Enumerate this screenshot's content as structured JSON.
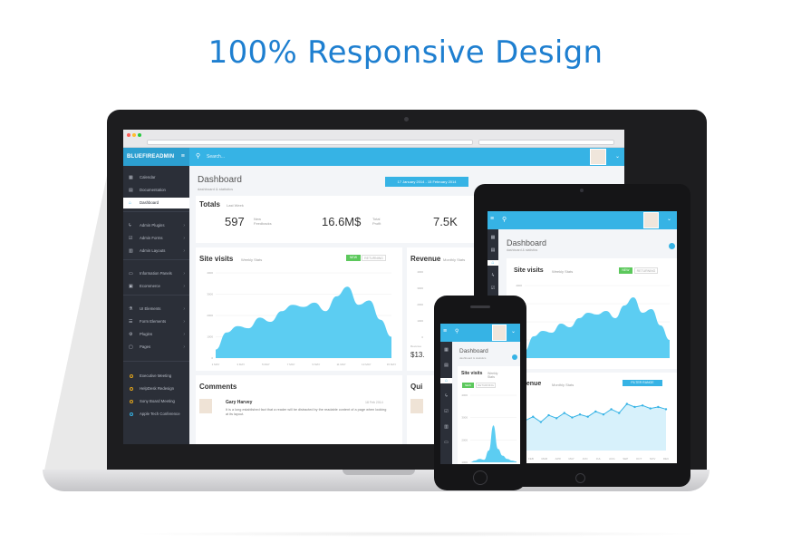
{
  "headline": "100% Responsive Design",
  "colors": {
    "accent": "#36b3e5",
    "headline": "#1e7fd0",
    "sidebar": "#2b2f38",
    "chart_fill": "#5ccdf2"
  },
  "laptop": {
    "brand": "BLUEFIREADMIN",
    "search_label": "Search...",
    "sidebar": {
      "items": [
        {
          "label": "Calendar",
          "icon": "calendar-icon",
          "arrow": false
        },
        {
          "label": "Documentation",
          "icon": "document-icon",
          "arrow": false
        },
        {
          "label": "Dashboard",
          "icon": "home-icon",
          "arrow": false,
          "active": true
        },
        {
          "label": "Admin Plugins",
          "icon": "plug-icon",
          "arrow": true
        },
        {
          "label": "Admin Forms",
          "icon": "check-icon",
          "arrow": true
        },
        {
          "label": "Admin Layouts",
          "icon": "layout-icon",
          "arrow": true
        },
        {
          "label": "Information Panels",
          "icon": "panel-icon",
          "arrow": true
        },
        {
          "label": "Ecommerce",
          "icon": "cart-icon",
          "arrow": true
        },
        {
          "label": "UI Elements",
          "icon": "flask-icon",
          "arrow": true
        },
        {
          "label": "Form Elements",
          "icon": "form-icon",
          "arrow": true
        },
        {
          "label": "Plugins",
          "icon": "gear-icon",
          "arrow": true
        },
        {
          "label": "Pages",
          "icon": "pages-icon",
          "arrow": true
        }
      ],
      "projects": [
        {
          "label": "Executive Meeting",
          "color": "#e3a51b"
        },
        {
          "label": "HelpDesk Redesign",
          "color": "#e3a51b"
        },
        {
          "label": "Sony Board Meeting",
          "color": "#e3a51b"
        },
        {
          "label": "Apple Tech Conference",
          "color": "#36b3e5"
        }
      ]
    },
    "page_title": "Dashboard",
    "page_subtitle": "dashboard & statistics",
    "date_range": "17 January 2014 - 15 February 2014",
    "totals": {
      "title": "Totals",
      "period": "Last Week",
      "stats": [
        {
          "value": "597",
          "label": "New Feedbacks"
        },
        {
          "value": "16.6M$",
          "label": "Total Profit"
        },
        {
          "value": "7.5K",
          "label": ""
        }
      ]
    },
    "site_visits": {
      "title": "Site visits",
      "subtitle": "Weekly Stats",
      "pill_new": "NEW",
      "pill_returning": "RETURNING",
      "y_ticks": [
        "4000",
        "3000",
        "2000",
        "1000",
        "0"
      ],
      "x_ticks": [
        "1 MAY",
        "3 MAY",
        "5 MAY",
        "7 MAY",
        "9 MAY",
        "11 MAY",
        "13 MAY",
        "15 MAY"
      ]
    },
    "revenue": {
      "title": "Revenue",
      "subtitle": "Monthly Stats",
      "tag": "Revenue",
      "value": "$13."
    },
    "comments": {
      "title": "Comments",
      "author": "Gary Harvey",
      "date": "18 Feb 2014",
      "text": "It is a long established fact that a reader will be distracted by the readable content of a page when looking at its layout."
    },
    "quick": "Qui"
  },
  "chart_data": [
    {
      "type": "area",
      "title": "Site visits",
      "x": [
        "1 MAY",
        "3 MAY",
        "5 MAY",
        "7 MAY",
        "9 MAY",
        "11 MAY",
        "13 MAY",
        "15 MAY"
      ],
      "series": [
        {
          "name": "NEW",
          "values": [
            400,
            1200,
            1500,
            1400,
            1900,
            1700,
            2200,
            2500,
            2400,
            2600,
            2200,
            2900,
            3350,
            2500,
            2700,
            1800,
            1000
          ]
        }
      ],
      "ylim": [
        0,
        4000
      ]
    },
    {
      "type": "line",
      "title": "Revenue",
      "series": [
        {
          "name": "Revenue",
          "values": [
            20,
            40,
            45,
            38,
            47,
            43,
            50,
            44,
            48,
            45,
            52,
            48,
            55,
            50,
            62,
            58,
            60,
            56,
            58,
            55
          ]
        }
      ],
      "x": [
        "JAN",
        "FEB",
        "MAR",
        "APR",
        "MAY",
        "JUN",
        "JUL",
        "AUG",
        "SEP",
        "OCT",
        "NOV",
        "DEC"
      ]
    }
  ],
  "tablet": {
    "page_title": "Dashboard",
    "page_subtitle": "dashboard & statistics",
    "site_visits": {
      "title": "Site visits",
      "subtitle": "Weekly Stats",
      "pill_new": "NEW",
      "pill_returning": "RETURNING"
    },
    "revenue": {
      "title": "venue",
      "subtitle": "Monthly Stats",
      "filter": "FILTER RANGE"
    },
    "revenue_x_ticks": [
      "JAN",
      "FEB",
      "MAR",
      "APR",
      "MAY",
      "JUN",
      "JUL",
      "AUG",
      "SEP",
      "OCT",
      "NOV",
      "DEC"
    ],
    "y_ticks": [
      "4000",
      "3000",
      "2000",
      "1000",
      "0"
    ]
  },
  "phone": {
    "page_title": "Dashboard",
    "page_subtitle": "dashboard & statistics",
    "site_visits": {
      "title": "Site visits",
      "subtitle": "Weekly Stats",
      "pill_new": "NEW",
      "pill_returning": "RETURNING"
    },
    "y_ticks": [
      "4000",
      "3000",
      "2000",
      "1000"
    ]
  }
}
